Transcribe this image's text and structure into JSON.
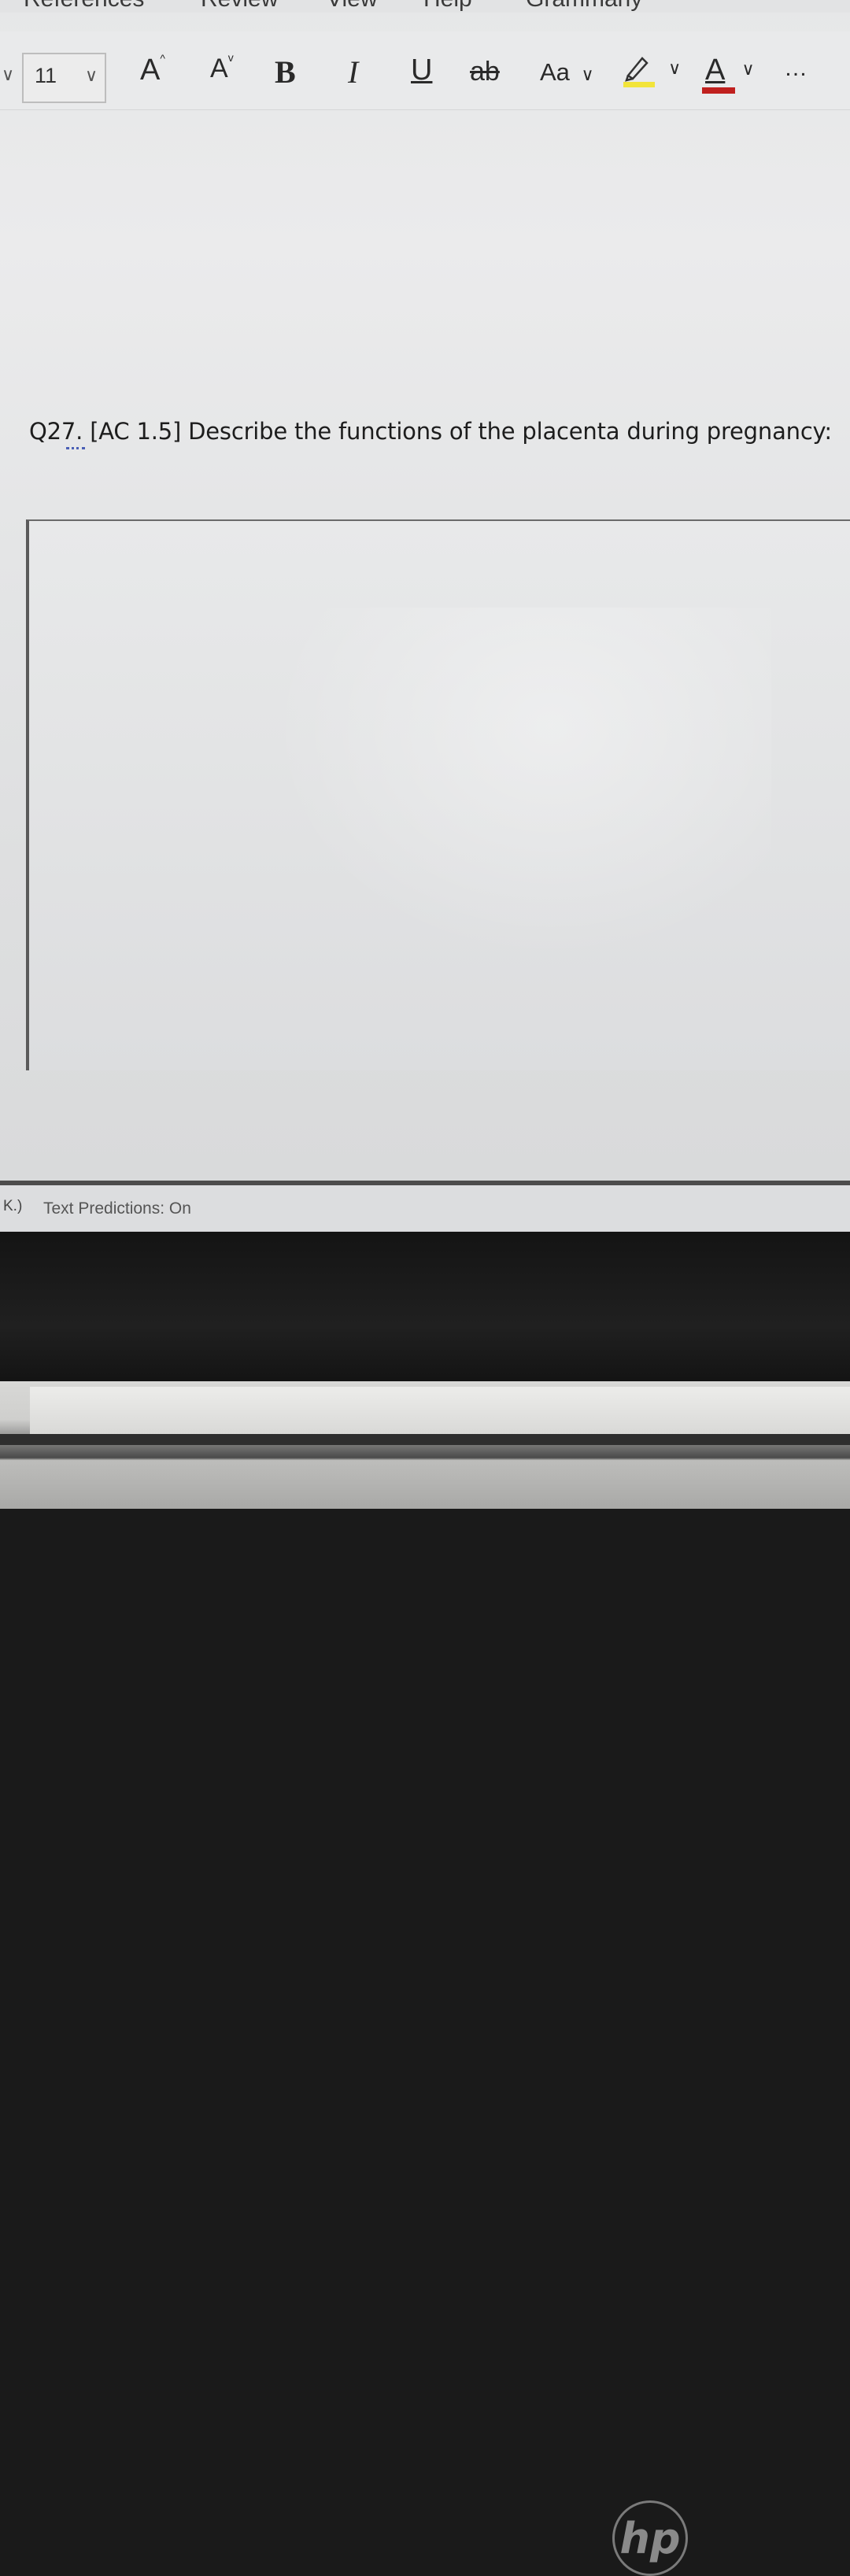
{
  "ribbon": {
    "tabs": [
      "References",
      "Review",
      "View",
      "Help",
      "Grammarly"
    ]
  },
  "toolbar": {
    "font_size": "11",
    "grow_font": "A",
    "shrink_font": "A",
    "bold": "B",
    "italic": "I",
    "underline": "U",
    "strikethrough": "ab",
    "change_case": "Aa",
    "font_color": "A",
    "more": "…",
    "chevron": "∨",
    "highlight_color": "#f2e43a",
    "font_color_bar": "#c0201e"
  },
  "document": {
    "question_number": "Q27.",
    "question_text": "[AC 1.5] Describe the functions of the placenta during pregnancy:"
  },
  "statusbar": {
    "left_fragment": "K.)",
    "text_predictions": "Text Predictions: On"
  },
  "bezel": {
    "logo": "hp"
  }
}
